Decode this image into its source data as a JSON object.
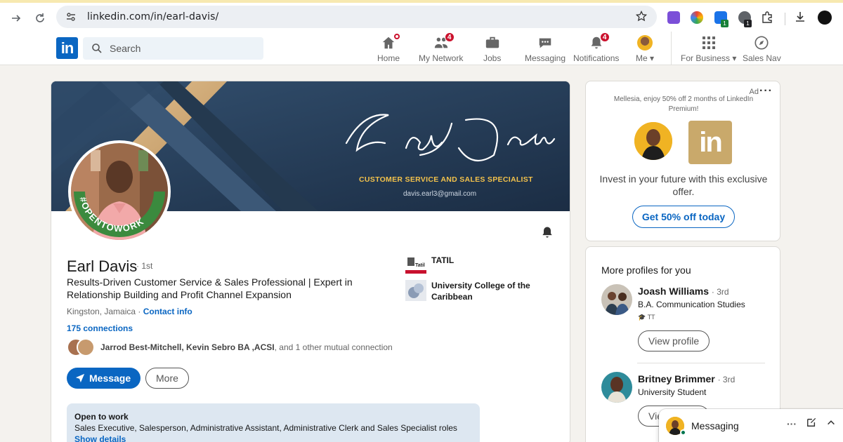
{
  "browser": {
    "url": "linkedin.com/in/earl-davis/",
    "ext_badge_1": "1",
    "ext_badge_2": "1"
  },
  "nav": {
    "logo_text": "in",
    "search_placeholder": "Search",
    "items": [
      {
        "label": "Home",
        "icon": "home-icon",
        "badge": "dot"
      },
      {
        "label": "My Network",
        "icon": "network-icon",
        "badge": "4"
      },
      {
        "label": "Jobs",
        "icon": "briefcase-icon",
        "badge": ""
      },
      {
        "label": "Messaging",
        "icon": "chat-icon",
        "badge": ""
      },
      {
        "label": "Notifications",
        "icon": "bell-icon",
        "badge": "4"
      },
      {
        "label": "Me",
        "icon": "avatar",
        "badge": ""
      },
      {
        "label": "For Business",
        "icon": "grid-icon",
        "badge": ""
      },
      {
        "label": "Sales Nav",
        "icon": "compass-icon",
        "badge": ""
      }
    ]
  },
  "profile": {
    "banner": {
      "script_name": "Earl Davis",
      "title": "CUSTOMER SERVICE AND SALES SPECIALIST",
      "email": "davis.earl3@gmail.com"
    },
    "open_to_work_frame": "#OPENTOWORK",
    "name": "Earl Davis",
    "degree": "· 1st",
    "headline": "Results-Driven Customer Service & Sales Professional | Expert in Relationship Building and Profit Channel Expansion",
    "location": "Kingston, Jamaica",
    "location_sep": " · ",
    "contact_info": "Contact info",
    "connections": "175 connections",
    "mutual": {
      "names": "Jarrod Best-Mitchell, Kevin Sebro BA ,ACSI",
      "rest": ", and 1 other mutual connection"
    },
    "message_button": "Message",
    "more_button": "More",
    "experience": [
      {
        "name": "TATIL",
        "logo": "tatil-logo"
      },
      {
        "name": "University College of the Caribbean",
        "logo": "ucc-logo"
      }
    ],
    "open_to_work": {
      "title": "Open to work",
      "roles": "Sales Executive, Salesperson, Administrative Assistant, Administrative Clerk and Sales Specialist roles",
      "link": "Show details"
    }
  },
  "ad": {
    "label": "Ad",
    "promo": "Mellesia, enjoy 50% off 2 months of LinkedIn Premium!",
    "logo_text": "in",
    "text": "Invest in your future with this exclusive offer.",
    "cta": "Get 50% off today"
  },
  "pymk": {
    "title": "More profiles for you",
    "people": [
      {
        "name": "Joash Williams",
        "degree": "· 3rd",
        "headline": "B.A. Communication Studies",
        "extra": "TT",
        "button": "View profile"
      },
      {
        "name": "Britney Brimmer",
        "degree": "· 3rd",
        "headline": "University Student",
        "button": "View profile"
      }
    ]
  },
  "messaging": {
    "title": "Messaging"
  },
  "colors": {
    "brand": "#0a66c2",
    "badge": "#cb112d",
    "open_to_work_green": "#2e7d32"
  }
}
